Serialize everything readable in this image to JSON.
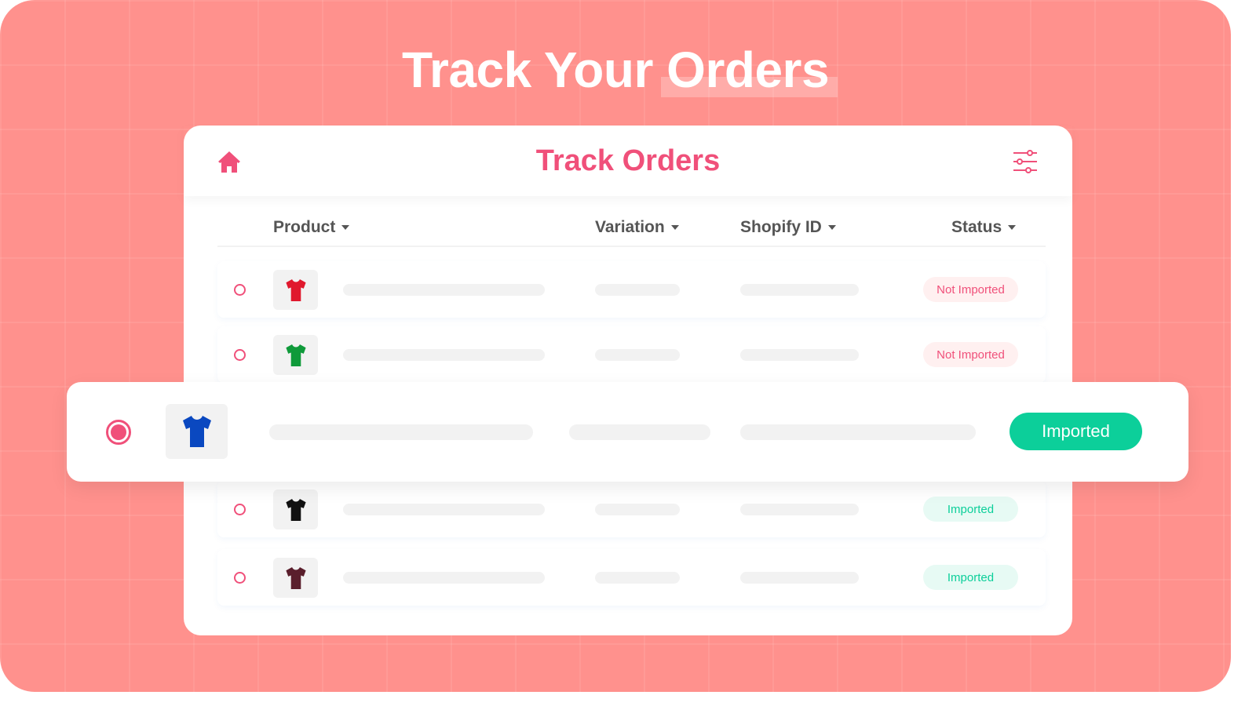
{
  "hero": {
    "title": "Track Your Orders"
  },
  "header": {
    "title": "Track Orders",
    "home_icon": "home-icon",
    "filter_icon": "sliders-icon"
  },
  "columns": [
    "Product",
    "Variation",
    "Shopify ID",
    "Status"
  ],
  "rows": [
    {
      "color": "#e0182d",
      "status": "Not Imported",
      "imported": false
    },
    {
      "color": "#0f9a3a",
      "status": "Not Imported",
      "imported": false
    },
    {
      "color": "#0a48c0",
      "status": "Imported",
      "imported": true,
      "selected": true
    },
    {
      "color": "#111111",
      "status": "Imported",
      "imported": true
    },
    {
      "color": "#5a1e2c",
      "status": "Imported",
      "imported": true
    }
  ],
  "colors": {
    "accent": "#f0507a",
    "success": "#0ccf9a",
    "background": "#ff918d"
  }
}
